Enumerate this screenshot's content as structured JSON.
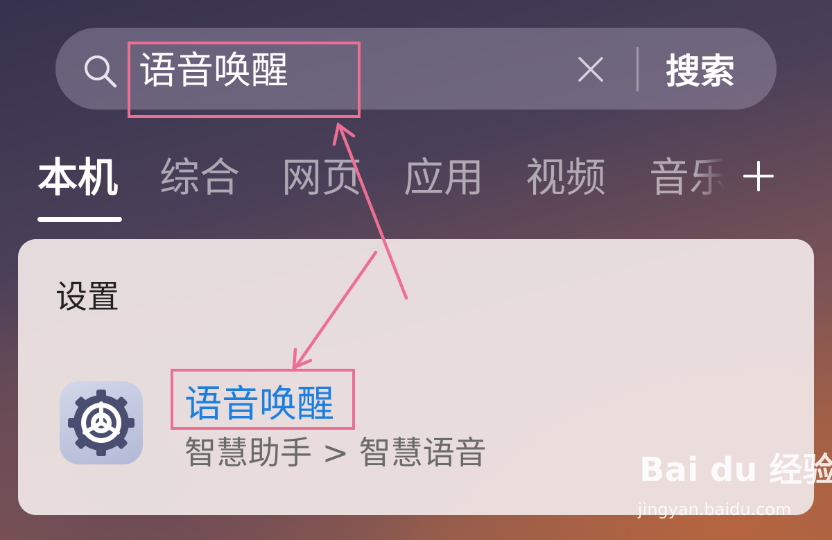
{
  "search": {
    "query": "语音唤醒",
    "submit_label": "搜索",
    "icon": "search-icon",
    "clear_icon": "close-icon"
  },
  "tabs": [
    {
      "label": "本机",
      "active": true
    },
    {
      "label": "综合",
      "active": false
    },
    {
      "label": "网页",
      "active": false
    },
    {
      "label": "应用",
      "active": false
    },
    {
      "label": "视频",
      "active": false
    },
    {
      "label": "音乐",
      "active": false
    }
  ],
  "add_tab_icon": "plus-icon",
  "results": {
    "section_title": "设置",
    "item": {
      "title": "语音唤醒",
      "path": "智慧助手 > 智慧语音",
      "icon": "settings-gear-icon"
    }
  },
  "annotation": {
    "color": "#ee6f94"
  },
  "watermark": {
    "logo_text": "Bai du 经验",
    "url": "jingyan.baidu.com"
  },
  "colors": {
    "link_blue": "#1b7fe0",
    "highlight_pink": "#ee6f94"
  }
}
